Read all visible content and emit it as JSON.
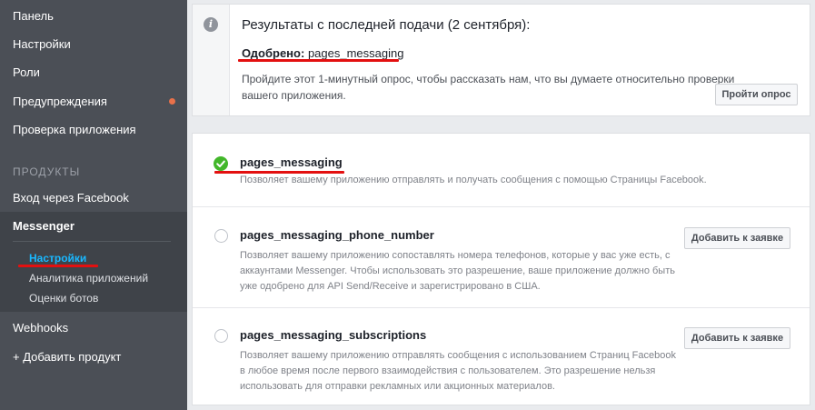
{
  "sidebar": {
    "items": [
      {
        "label": "Панель"
      },
      {
        "label": "Настройки"
      },
      {
        "label": "Роли"
      },
      {
        "label": "Предупреждения"
      },
      {
        "label": "Проверка приложения"
      }
    ],
    "section_label": "ПРОДУКТЫ",
    "facebook_login": "Вход через Facebook",
    "messenger": {
      "title": "Messenger",
      "sub_items": [
        {
          "label": "Настройки"
        },
        {
          "label": "Аналитика приложений"
        },
        {
          "label": "Оценки ботов"
        }
      ]
    },
    "webhooks": "Webhooks",
    "add_product": "+ Добавить продукт"
  },
  "notice": {
    "title": "Результаты с последней подачи (2 сентября):",
    "approved_label": "Одобрено:",
    "approved_value": "pages_messaging",
    "survey_text": "Пройдите этот 1-минутный опрос, чтобы рассказать нам, что вы думаете относительно проверки вашего приложения.",
    "survey_button": "Пройти опрос"
  },
  "permissions": [
    {
      "name": "pages_messaging",
      "description": "Позволяет вашему приложению отправлять и получать сообщения с помощью Страницы Facebook."
    },
    {
      "name": "pages_messaging_phone_number",
      "description": "Позволяет вашему приложению сопоставлять номера телефонов, которые у вас уже есть, с аккаунтами Messenger. Чтобы использовать это разрешение, ваше приложение должно быть уже одобрено для API Send/Receive и зарегистрировано в США.",
      "button": "Добавить к заявке"
    },
    {
      "name": "pages_messaging_subscriptions",
      "description": "Позволяет вашему приложению отправлять сообщения с использованием Страниц Facebook в любое время после первого взаимодействия с пользователем. Это разрешение нельзя использовать для отправки рекламных или акционных материалов.",
      "button": "Добавить к заявке"
    }
  ],
  "colors": {
    "sidebar_bg": "#4b4f56",
    "active_link": "#19b8ff",
    "approved_check": "#42b72a",
    "alert_dot": "#e9714a",
    "annotation_underline": "#e31010"
  },
  "icons": {
    "info": "info-icon",
    "approved": "check-icon",
    "pending": "radio-icon",
    "alert": "alert-dot-icon"
  }
}
